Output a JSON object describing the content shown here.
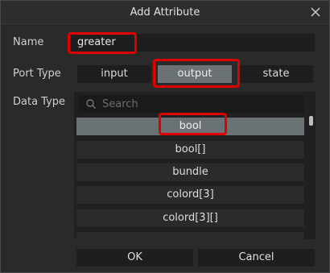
{
  "dialog": {
    "title": "Add Attribute"
  },
  "form": {
    "name_label": "Name",
    "name_value": "greater",
    "port_type_label": "Port Type",
    "port_types": [
      "input",
      "output",
      "state"
    ],
    "port_type_selected": "output",
    "data_type_label": "Data Type"
  },
  "data_type_list": {
    "search_placeholder": "Search",
    "items": [
      "bool",
      "bool[]",
      "bundle",
      "colord[3]",
      "colord[3][]"
    ],
    "selected": "bool"
  },
  "footer": {
    "ok_label": "OK",
    "cancel_label": "Cancel"
  },
  "icons": {
    "close": "close-icon",
    "search": "search-icon"
  },
  "colors": {
    "highlight": "#e00000",
    "selected_background": "#6b7274",
    "dialog_background": "#2a2a2a"
  }
}
